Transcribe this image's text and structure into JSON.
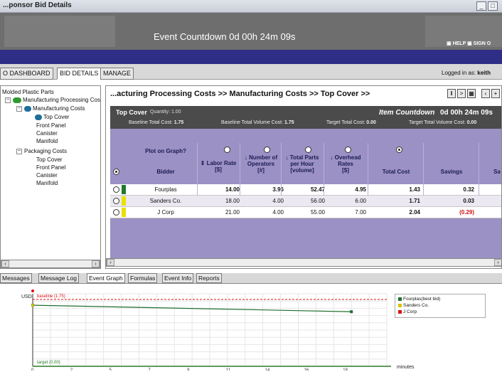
{
  "window": {
    "title": "...ponsor Bid Details"
  },
  "banner": {
    "countdown": "Event Countdown 0d 00h 24m 09s",
    "help": "HELP",
    "signout": "SIGN O"
  },
  "top_tabs": [
    {
      "label": "O DASHBOARD"
    },
    {
      "label": "BID DETAILS"
    },
    {
      "label": "MANAGE"
    }
  ],
  "logged_in": {
    "prefix": "Logged in as:",
    "user": "keith"
  },
  "tree": {
    "root": "Molded Plastic Parts",
    "group1": "Manufacturing Processing Cos",
    "group1_child": "Manufacturing Costs",
    "group1_items": [
      "Top Cover",
      "Front Panel",
      "Canister",
      "Manifold"
    ],
    "group2": "Packaging Costs",
    "group2_items": [
      "Top Cover",
      "Front Panel",
      "Canister",
      "Manifold"
    ]
  },
  "breadcrumb": "...acturing Processing Costs >> Manufacturing Costs >> Top Cover >>",
  "item": {
    "name": "Top Cover",
    "quantity": "Quantity: 1.00",
    "countdown_label": "Item Countdown",
    "countdown_value": "0d 00h 24m 09s",
    "baseline_total_label": "Baseline Total Cost:",
    "baseline_total_value": "1.75",
    "baseline_volume_label": "Baseline Total Volume Cost:",
    "baseline_volume_value": "1.75",
    "target_total_label": "Target Total Cost:",
    "target_total_value": "0.00",
    "target_volume_label": "Target Total Volume Cost:",
    "target_volume_value": "0.00"
  },
  "grid": {
    "plot_label": "Plot on Graph?",
    "headers": {
      "bidder": "Bidder",
      "labor_rate": "Labor Rate",
      "labor_unit": "[$]",
      "operators": "Number of Operators",
      "operators_unit": "[#]",
      "parts": "Total Parts per Hour",
      "parts_unit": "[volume]",
      "overhead": "Overhead Rates",
      "overhead_unit": "[$]",
      "total": "Total Cost",
      "savings": "Savings",
      "next": "Sa"
    },
    "rows": [
      {
        "bidder": "Fourplas",
        "labor": "14.00",
        "operators": "3.96",
        "parts": "52.47",
        "overhead": "4.95",
        "total": "1.43",
        "savings": "0.32",
        "status_color": "#1f7a2e"
      },
      {
        "bidder": "Sanders Co.",
        "labor": "18.00",
        "operators": "4.00",
        "parts": "56.00",
        "overhead": "6.00",
        "total": "1.71",
        "savings": "0.03",
        "status_color": "#e8e000"
      },
      {
        "bidder": "J Corp",
        "labor": "21.00",
        "operators": "4.00",
        "parts": "55.00",
        "overhead": "7.00",
        "total": "2.04",
        "savings": "(0.29)",
        "status_color": "#e8e000"
      }
    ]
  },
  "bottom_tabs": [
    {
      "label": "Messages"
    },
    {
      "label": "Message Log"
    },
    {
      "label": "Event Graph"
    },
    {
      "label": "Formulas"
    },
    {
      "label": "Event Info"
    },
    {
      "label": "Reports"
    }
  ],
  "chart_data": {
    "type": "line",
    "ylabel": "USD",
    "xlabel": "minutes",
    "x_ticks": [
      "0",
      "2",
      "5",
      "7",
      "9",
      "11",
      "14",
      "16",
      "18"
    ],
    "baseline_label": "baseline (1.75)",
    "target_label": "target (0.00)",
    "ylim": [
      0,
      1.9
    ],
    "xlim": [
      0,
      20
    ],
    "series": [
      {
        "name": "Fourplas(best bid)",
        "color": "#1f6e2e",
        "x": [
          0,
          18
        ],
        "y": [
          1.6,
          1.43
        ]
      },
      {
        "name": "Sanders Co.",
        "color": "#d4c400",
        "x": [
          0,
          18
        ],
        "y": [
          1.71,
          1.71
        ]
      },
      {
        "name": "J Corp",
        "color": "#dd1111",
        "x": [
          0,
          18
        ],
        "y": [
          2.04,
          2.04
        ]
      }
    ],
    "baseline_value": 1.75,
    "target_value": 0.0
  }
}
